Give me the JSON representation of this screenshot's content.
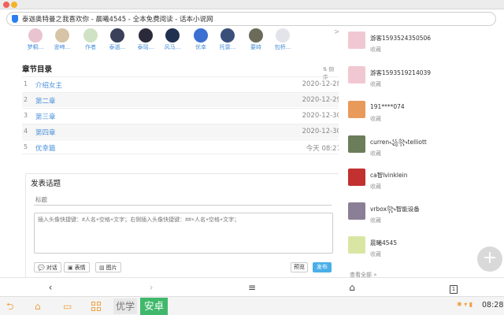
{
  "browser": {
    "url_title": "泰迦奥特曼之我喜欢你 - 晨曦4545 - 全本免费阅读 - 话本小说网"
  },
  "readers": [
    {
      "name": "梦桐..."
    },
    {
      "name": "逊啼..."
    },
    {
      "name": "作者"
    },
    {
      "name": "泰迦..."
    },
    {
      "name": "泰瑶..."
    },
    {
      "name": "风马..."
    },
    {
      "name": "优幸"
    },
    {
      "name": "托雷..."
    },
    {
      "name": "要峙"
    },
    {
      "name": "包桥..."
    }
  ],
  "chapters": {
    "title": "章节目录",
    "sort_label": "倒序",
    "items": [
      {
        "num": "1",
        "title": "介绍女主",
        "date": "2020-12-28"
      },
      {
        "num": "2",
        "title": "第二章",
        "date": "2020-12-29"
      },
      {
        "num": "3",
        "title": "第三章",
        "date": "2020-12-30"
      },
      {
        "num": "4",
        "title": "第四章",
        "date": "2020-12-30"
      },
      {
        "num": "5",
        "title": "优幸篇",
        "date": "今天 08:27"
      }
    ]
  },
  "post": {
    "title": "发表话题",
    "title_placeholder": "标题",
    "content_placeholder": "插入头像快捷键：#人名+空格+文字；右侧插入头像快捷键：##+人名+空格+文字；",
    "btn_dialog": "对话",
    "btn_emoji": "表情",
    "btn_image": "图片",
    "btn_preview": "预览",
    "btn_publish": "发布"
  },
  "sidebar": {
    "users": [
      {
        "name": "游客1593524350506",
        "label": "收藏",
        "color": "#f1c8d2"
      },
      {
        "name": "游客1593519214039",
        "label": "收藏",
        "color": "#f1c8d2"
      },
      {
        "name": "191****074",
        "label": "收藏",
        "color": "#e89a5a"
      },
      {
        "name": "curren꧁꧂telliott",
        "label": "收藏",
        "color": "#6c7d5a"
      },
      {
        "name": "ca智lvinklein",
        "label": "收藏",
        "color": "#c23030"
      },
      {
        "name": "vrbox꧂智能设备",
        "label": "收藏",
        "color": "#8a7f96"
      },
      {
        "name": "晨曦4545",
        "label": "收藏",
        "color": "#d9e6a3"
      }
    ],
    "more": "查看全部 »"
  },
  "system": {
    "brand1": "优学",
    "brand2": "安卓",
    "time": "08:28"
  }
}
